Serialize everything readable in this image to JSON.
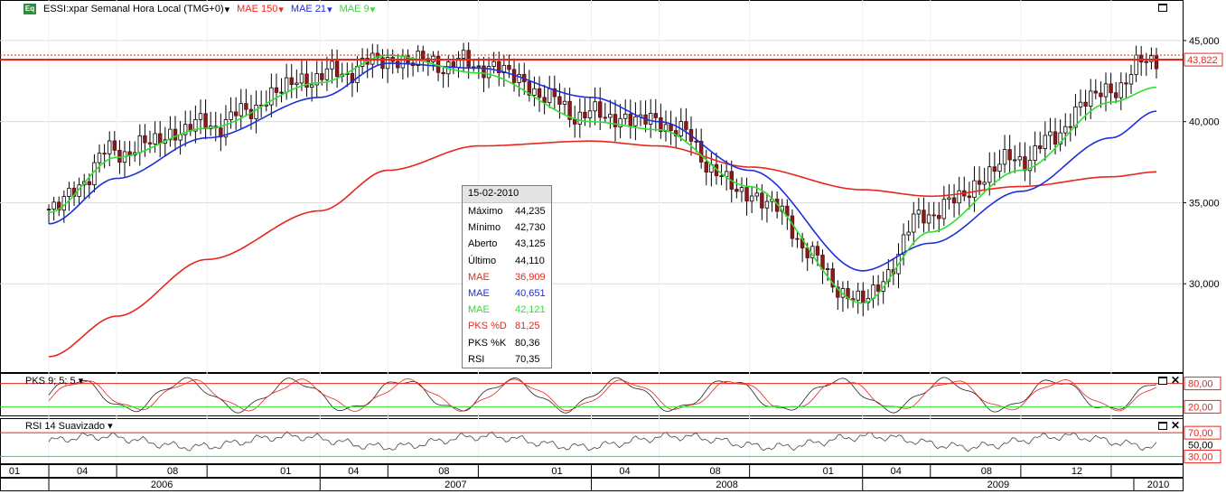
{
  "header": {
    "icon_label": "Eq",
    "instrument": "ESSI:xpar Semanal Hora Local (TMG+0)",
    "indicators": [
      {
        "label": "MAE 150",
        "color": "#e8261c"
      },
      {
        "label": "MAE 21",
        "color": "#1c2ee0"
      },
      {
        "label": "MAE 9",
        "color": "#2fe02f"
      }
    ]
  },
  "tooltip": {
    "date": "15-02-2010",
    "rows": [
      {
        "label": "Máximo",
        "value": "44,235",
        "color": "#000000"
      },
      {
        "label": "Mínimo",
        "value": "42,730",
        "color": "#000000"
      },
      {
        "label": "Aberto",
        "value": "43,125",
        "color": "#000000"
      },
      {
        "label": "Último",
        "value": "44,110",
        "color": "#000000"
      },
      {
        "label": "MAE",
        "value": "36,909",
        "color": "#e8261c"
      },
      {
        "label": "MAE",
        "value": "40,651",
        "color": "#1c2ee0"
      },
      {
        "label": "MAE",
        "value": "42,121",
        "color": "#2fe02f"
      },
      {
        "label": "PKS %D",
        "value": "81,25",
        "color": "#e8261c"
      },
      {
        "label": "PKS %K",
        "value": "80,36",
        "color": "#000000"
      },
      {
        "label": "RSI",
        "value": "70,35",
        "color": "#000000"
      }
    ]
  },
  "subpanels": {
    "pks_label": "PKS 9; 5; 5",
    "rsi_label": "RSI 14 Suavizado"
  },
  "price_axis": {
    "ticks": [
      "45,000",
      "40,000",
      "35,000",
      "30,000"
    ],
    "last_value": "43,822"
  },
  "pks_axis": {
    "upper": "80,00",
    "lower": "20,00"
  },
  "rsi_axis": {
    "upper": "70,00",
    "mid": "50,00",
    "lower": "30,00"
  },
  "time_axis": {
    "months": [
      "01",
      "04",
      "08",
      "01",
      "04",
      "08",
      "01",
      "04",
      "08",
      "01",
      "04",
      "08",
      "12"
    ],
    "years": [
      "2006",
      "2007",
      "2008",
      "2009",
      "2010"
    ]
  },
  "chart_data": {
    "type": "candlestick",
    "frequency": "weekly",
    "ylim": [
      25,
      47
    ],
    "horizontal_line": 43.822,
    "x": [
      "2006-01",
      "2006-04",
      "2006-08",
      "2007-01",
      "2007-04",
      "2007-08",
      "2008-01",
      "2008-04",
      "2008-08",
      "2009-01",
      "2009-04",
      "2009-08",
      "2009-12",
      "2010-02"
    ],
    "close": [
      34.6,
      38.2,
      39.8,
      42.8,
      43.8,
      43.5,
      40.4,
      40.0,
      35.5,
      29.0,
      34.5,
      37.8,
      42.0,
      44.1
    ],
    "series": [
      {
        "name": "MAE 150",
        "values": [
          25.5,
          28.0,
          31.5,
          34.5,
          37.0,
          38.5,
          38.8,
          38.5,
          37.2,
          35.8,
          35.4,
          36.0,
          36.6,
          36.9
        ]
      },
      {
        "name": "MAE 21",
        "values": [
          33.7,
          36.5,
          39.0,
          41.5,
          43.6,
          43.3,
          41.5,
          40.0,
          37.0,
          30.8,
          32.5,
          35.7,
          39.0,
          40.65
        ]
      },
      {
        "name": "MAE 9",
        "values": [
          34.4,
          37.8,
          39.6,
          42.4,
          44.1,
          43.0,
          40.0,
          39.5,
          36.0,
          28.8,
          33.2,
          37.0,
          41.2,
          42.12
        ]
      }
    ]
  }
}
